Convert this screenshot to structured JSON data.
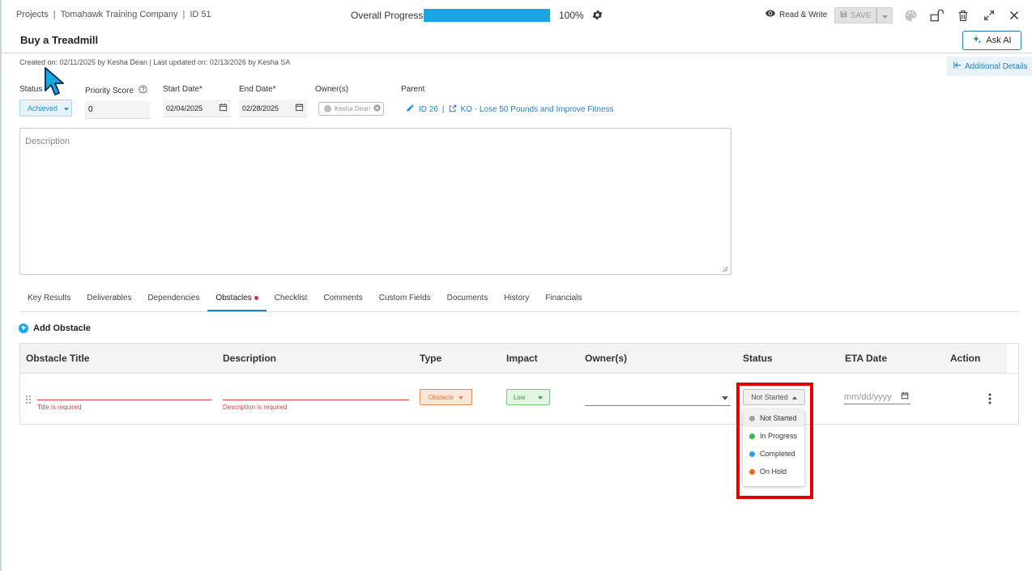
{
  "breadcrumb": {
    "root": "Projects",
    "company": "Tomahawk Training Company",
    "id": "ID 51"
  },
  "progress": {
    "label": "Overall Progress",
    "percent_text": "100%",
    "value": 1.0,
    "fill_color": "#1aa6e4"
  },
  "toolbar": {
    "mode_label": "Read & Write",
    "save_label": "SAVE"
  },
  "page": {
    "title": "Buy a Treadmill",
    "ask_ai_label": "Ask AI",
    "meta": "Created on: 02/11/2025 by Kesha Dean  |  Last updated on: 02/13/2026 by Kesha SA",
    "additional_details_label": "Additional Details"
  },
  "fields": {
    "status_label": "Status",
    "status_value": "Achieved",
    "priority_label": "Priority Score",
    "priority_value": "0",
    "start_label": "Start Date*",
    "start_value": "02/04/2025",
    "end_label": "End Date*",
    "end_value": "02/28/2025",
    "owners_label": "Owner(s)",
    "owner_chip": "Kesha Dean",
    "parent_label": "Parent",
    "parent_id": "ID 26",
    "parent_sep": "|",
    "parent_name": "KO - Lose 50 Pounds and Improve Fitness",
    "description_placeholder": "Description"
  },
  "tabs": [
    {
      "label": "Key Results"
    },
    {
      "label": "Deliverables"
    },
    {
      "label": "Dependencies"
    },
    {
      "label": "Obstacles"
    },
    {
      "label": "Checklist"
    },
    {
      "label": "Comments"
    },
    {
      "label": "Custom Fields"
    },
    {
      "label": "Documents"
    },
    {
      "label": "History"
    },
    {
      "label": "Financials"
    }
  ],
  "obstacles": {
    "add_label": "Add Obstacle",
    "columns": [
      "Obstacle Title",
      "Description",
      "Type",
      "Impact",
      "Owner(s)",
      "Status",
      "ETA Date",
      "Action"
    ],
    "row": {
      "title_error": "Title is required",
      "description_error": "Description is required",
      "type_value": "Obstacle",
      "impact_value": "Low",
      "status_value": "Not Started",
      "eta_placeholder": "mm/dd/yyyy"
    },
    "status_menu": [
      {
        "label": "Not Started",
        "color": "#9aa3ad"
      },
      {
        "label": "In Progress",
        "color": "#3cb44b"
      },
      {
        "label": "Completed",
        "color": "#2fa3e0"
      },
      {
        "label": "On Hold",
        "color": "#f2661f"
      }
    ]
  }
}
